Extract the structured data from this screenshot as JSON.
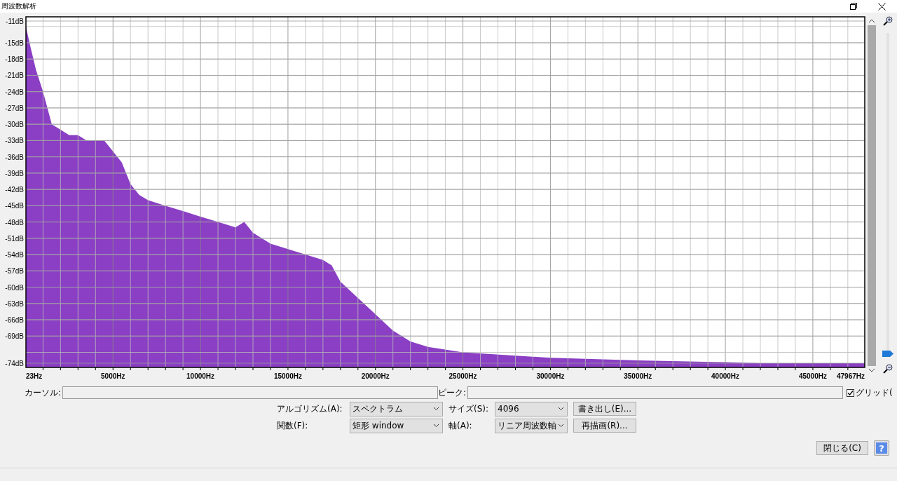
{
  "window": {
    "title": "周波数解析"
  },
  "spectrum": {
    "chart_data": {
      "type": "area",
      "grid": true,
      "x": [
        23,
        300,
        600,
        1000,
        1500,
        2000,
        2500,
        3000,
        3500,
        4000,
        4500,
        5000,
        5500,
        6000,
        6500,
        7000,
        8000,
        9000,
        10000,
        11000,
        12000,
        12500,
        13000,
        14000,
        15000,
        16000,
        17000,
        17500,
        18000,
        19000,
        20000,
        21000,
        22000,
        23000,
        25000,
        30000,
        35000,
        40000,
        42000,
        47967
      ],
      "series": [
        {
          "color": "#8a3fc4",
          "values": [
            -12,
            -16,
            -20,
            -24,
            -30,
            -31,
            -32,
            -32,
            -33,
            -33,
            -33,
            -35,
            -37,
            -41,
            -43,
            -44,
            -45,
            -46,
            -47,
            -48,
            -49,
            -48,
            -50,
            -52,
            -53,
            -54,
            -55,
            -56,
            -59,
            -62,
            -65,
            -68,
            -70,
            -71,
            -72,
            -73,
            -73.5,
            -73.8,
            -74,
            -74
          ]
        }
      ],
      "xlim": [
        23,
        47967
      ],
      "ylim": [
        -74,
        -11
      ],
      "xticks": [
        {
          "value": 23,
          "label": "23Hz"
        },
        {
          "value": 5000,
          "label": "5000Hz"
        },
        {
          "value": 10000,
          "label": "10000Hz"
        },
        {
          "value": 15000,
          "label": "15000Hz"
        },
        {
          "value": 20000,
          "label": "20000Hz"
        },
        {
          "value": 25000,
          "label": "25000Hz"
        },
        {
          "value": 30000,
          "label": "30000Hz"
        },
        {
          "value": 35000,
          "label": "35000Hz"
        },
        {
          "value": 40000,
          "label": "40000Hz"
        },
        {
          "value": 45000,
          "label": "45000Hz"
        },
        {
          "value": 47967,
          "label": "47967Hz"
        }
      ],
      "yticks": [
        {
          "value": -11,
          "label": "-11dB"
        },
        {
          "value": -15,
          "label": "-15dB"
        },
        {
          "value": -18,
          "label": "-18dB"
        },
        {
          "value": -21,
          "label": "-21dB"
        },
        {
          "value": -24,
          "label": "-24dB"
        },
        {
          "value": -27,
          "label": "-27dB"
        },
        {
          "value": -30,
          "label": "-30dB"
        },
        {
          "value": -33,
          "label": "-33dB"
        },
        {
          "value": -36,
          "label": "-36dB"
        },
        {
          "value": -39,
          "label": "-39dB"
        },
        {
          "value": -42,
          "label": "-42dB"
        },
        {
          "value": -45,
          "label": "-45dB"
        },
        {
          "value": -48,
          "label": "-48dB"
        },
        {
          "value": -51,
          "label": "-51dB"
        },
        {
          "value": -54,
          "label": "-54dB"
        },
        {
          "value": -57,
          "label": "-57dB"
        },
        {
          "value": -60,
          "label": "-60dB"
        },
        {
          "value": -63,
          "label": "-63dB"
        },
        {
          "value": -66,
          "label": "-66dB"
        },
        {
          "value": -69,
          "label": "-69dB"
        },
        {
          "value": -74,
          "label": "-74dB"
        }
      ]
    }
  },
  "zoom_slider": {
    "level": 0
  },
  "cursor": {
    "label": "カーソル:"
  },
  "peak": {
    "label": "ピーク:"
  },
  "grid": {
    "label": "グリッド(",
    "checked": true
  },
  "algorithm": {
    "label": "アルゴリズム(A):",
    "value": "スペクトラム"
  },
  "size": {
    "label": "サイズ(S):",
    "value": "4096"
  },
  "export_button": "書き出し(E)...",
  "function": {
    "label": "関数(F):",
    "value": "矩形 window"
  },
  "axis": {
    "label": "軸(A):",
    "value": "リニア周波数軸"
  },
  "replot_button": "再描画(R)...",
  "close_button": "閉じる(C)",
  "help_button": "?"
}
